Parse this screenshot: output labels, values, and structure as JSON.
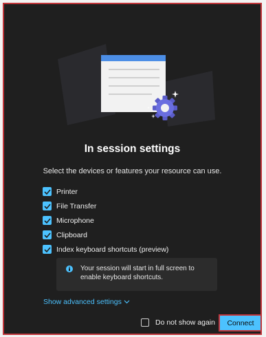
{
  "dialog": {
    "title": "In session settings",
    "subtitle": "Select the devices or features your resource can use.",
    "options": [
      {
        "label": "Printer",
        "checked": true
      },
      {
        "label": "File Transfer",
        "checked": true
      },
      {
        "label": "Microphone",
        "checked": true
      },
      {
        "label": "Clipboard",
        "checked": true
      },
      {
        "label": "Index keyboard shortcuts (preview)",
        "checked": true
      }
    ],
    "info_line1": "Your session will start in full screen to",
    "info_line2": "enable keyboard shortcuts.",
    "advanced_link": "Show advanced settings",
    "do_not_show_label": "Do not show again",
    "connect_label": "Connect"
  },
  "colors": {
    "background": "#1f1f1f",
    "accent": "#4cc2ff",
    "focus_border": "#c0353a"
  },
  "icons": {
    "illustration": "window-with-gear-illustration",
    "checkbox": "checkmark-icon",
    "info": "info-icon",
    "chevron": "chevron-down-icon"
  }
}
